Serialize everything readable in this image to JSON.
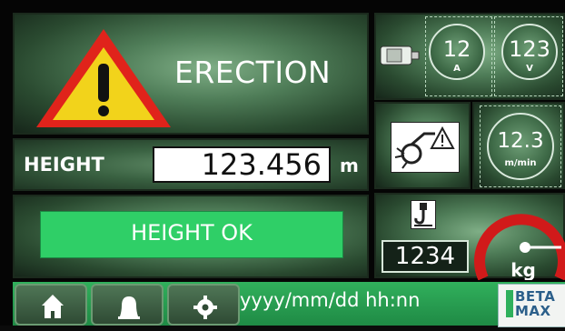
{
  "mode": {
    "label": "ERECTION"
  },
  "height": {
    "label": "HEIGHT",
    "value": "123.456",
    "unit": "m"
  },
  "status": {
    "message": "HEIGHT OK"
  },
  "motor": {
    "current": {
      "value": "12",
      "unit": "A"
    },
    "voltage": {
      "value": "123",
      "unit": "V"
    }
  },
  "speed": {
    "value": "12.3",
    "unit": "m/min"
  },
  "load": {
    "value": "1234",
    "unit": "kg",
    "gauge_fraction": 0.72
  },
  "bottom_bar": {
    "datetime": "yyyy/mm/dd hh:nn",
    "buttons": [
      {
        "icon": "home-icon"
      },
      {
        "icon": "bell-icon"
      },
      {
        "icon": "gear-icon"
      }
    ],
    "logo": {
      "line1": "BETA",
      "line2": "MAX"
    }
  },
  "colors": {
    "status_ok": "#2fcf67",
    "warning_red": "#e0231b",
    "warning_yellow": "#f2d31b",
    "gauge_arc": "#d11a1a",
    "bar_green": "#2aa557"
  }
}
